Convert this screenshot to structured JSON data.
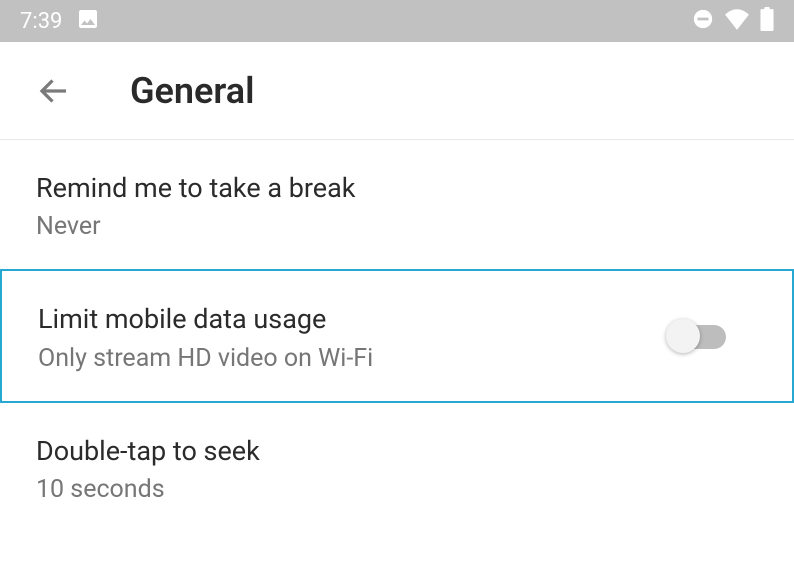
{
  "status": {
    "time": "7:39"
  },
  "header": {
    "title": "General"
  },
  "settings": {
    "remind": {
      "title": "Remind me to take a break",
      "sub": "Never"
    },
    "limit": {
      "title": "Limit mobile data usage",
      "sub": "Only stream HD video on Wi-Fi"
    },
    "seek": {
      "title": "Double-tap to seek",
      "sub": "10 seconds"
    }
  }
}
